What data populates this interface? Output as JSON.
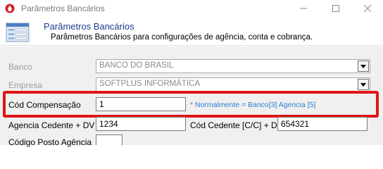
{
  "window": {
    "title": "Parâmetros Bancários",
    "controls": {
      "minimize": "minimize-icon",
      "maximize": "maximize-icon",
      "close": "close-icon"
    }
  },
  "header": {
    "title": "Parâmetros Bancários",
    "subtitle": "Parâmetros Bancários para configurações de agência, conta e cobrança."
  },
  "form": {
    "banco": {
      "label": "Banco",
      "value": "BANCO DO BRASIL",
      "enabled": false
    },
    "empresa": {
      "label": "Empresa",
      "value": "SOFTPLUS INFORMÁTICA",
      "enabled": false
    },
    "cod_compensacao": {
      "label": "Cód Compensação",
      "value": "1",
      "hint": "* Normalmente  = Banco[3] Agencia [5]"
    },
    "agencia_cedente": {
      "label": "Agencia Cedente + DV",
      "value": "1234"
    },
    "cod_cedente": {
      "label": "Cód Cedente [C/C] + DV",
      "value": "654321"
    },
    "codigo_posto_agencia": {
      "label": "Código Posto Agência",
      "value": ""
    }
  },
  "colors": {
    "highlight": "#e01616",
    "header_title": "#1c3d8c",
    "hint": "#2a80d6"
  }
}
